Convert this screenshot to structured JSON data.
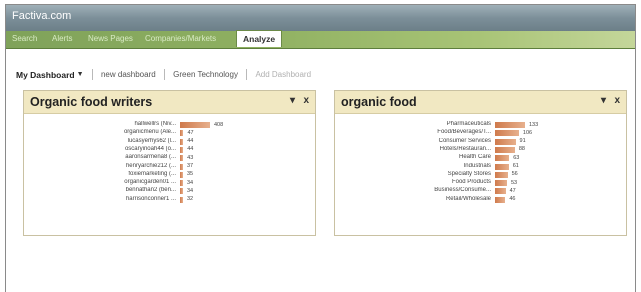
{
  "app": {
    "title": "Factiva.com"
  },
  "nav": {
    "tabs": [
      {
        "label": "Search",
        "active": false
      },
      {
        "label": "Alerts",
        "active": false
      },
      {
        "label": "News Pages",
        "active": false
      },
      {
        "label": "Companies/Markets",
        "active": false
      },
      {
        "label": "Analyze",
        "active": true
      }
    ]
  },
  "dashboard_bar": {
    "my_dashboard": "My Dashboard",
    "new_dashboard": "new dashboard",
    "green_technology": "Green Technology",
    "add_dashboard": "Add Dashboard"
  },
  "panels": [
    {
      "title": "Organic food writers",
      "minimize_label": "▾",
      "close_label": "x",
      "chart_data": {
        "type": "bar",
        "orientation": "horizontal",
        "categories": [
          "hallwellrs (Niv...",
          "organicmenu (Ale...",
          "lucasyerhys62 (l...",
          "oscaryinoah44 (o...",
          "aaronsarmena8 (...",
          "henryarchie212 (...",
          "foxiemarketing (...",
          "organicgarden01 ...",
          "bennathan2 (ben...",
          "harrisonconner1 ..."
        ],
        "values": [
          408,
          47,
          44,
          44,
          43,
          37,
          35,
          34,
          34,
          32
        ],
        "value_labels": [
          "408",
          "47",
          "44",
          "44",
          "43",
          "37",
          "35",
          "34",
          "34",
          "32"
        ]
      }
    },
    {
      "title": "organic food",
      "minimize_label": "▾",
      "close_label": "x",
      "chart_data": {
        "type": "bar",
        "orientation": "horizontal",
        "categories": [
          "Pharmaceuticals",
          "Food/Beverages/T...",
          "Consumer Services",
          "Hotels/Restauran...",
          "Health Care",
          "Industrials",
          "Specialty Stores",
          "Food Products",
          "Business/Consume...",
          "Retail/Wholesale"
        ],
        "values": [
          133,
          106,
          91,
          88,
          63,
          61,
          56,
          53,
          47,
          46
        ],
        "value_labels": [
          "133",
          "106",
          "91",
          "88",
          "63",
          "61",
          "56",
          "53",
          "47",
          "46"
        ]
      }
    }
  ],
  "colors": {
    "bar_fill": "#cf7a4c",
    "panel_header": "#f1e8c2",
    "nav_green": "#8fb061"
  }
}
